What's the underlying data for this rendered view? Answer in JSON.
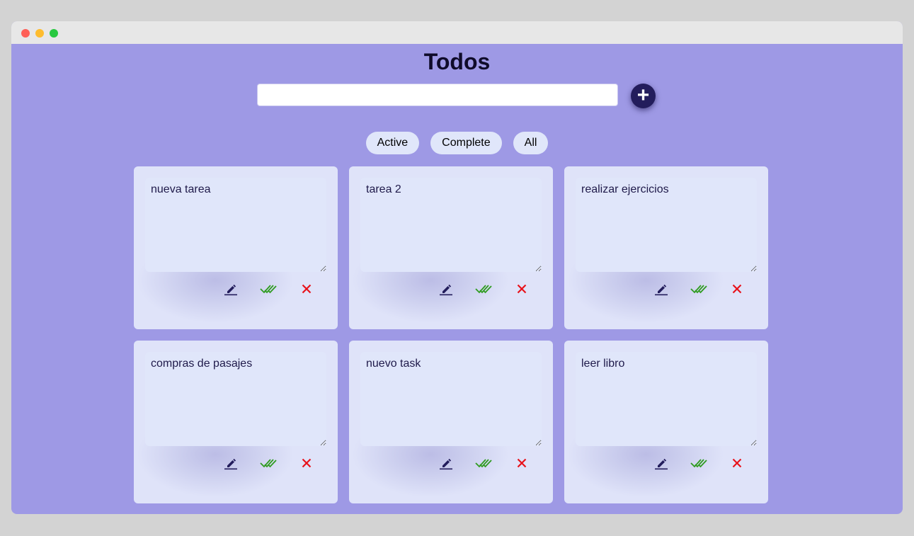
{
  "app": {
    "title": "Todos"
  },
  "new_todo": {
    "value": "",
    "placeholder": ""
  },
  "add_button": {
    "label": "+"
  },
  "filters": [
    {
      "label": "Active"
    },
    {
      "label": "Complete"
    },
    {
      "label": "All"
    }
  ],
  "todos": [
    {
      "text": "nueva tarea"
    },
    {
      "text": "tarea 2"
    },
    {
      "text": "realizar ejercicios"
    },
    {
      "text": "compras de pasajes"
    },
    {
      "text": "nuevo task"
    },
    {
      "text": "leer libro"
    }
  ],
  "icons": {
    "edit": "pencil-icon",
    "complete": "double-check-icon",
    "delete": "close-icon"
  },
  "colors": {
    "background": "#9e99e5",
    "card": "#dfe3f9",
    "edit_icon": "#231d5c",
    "complete_icon": "#2e9b1f",
    "delete_icon": "#e8121b",
    "add_button": "#231d5c"
  }
}
